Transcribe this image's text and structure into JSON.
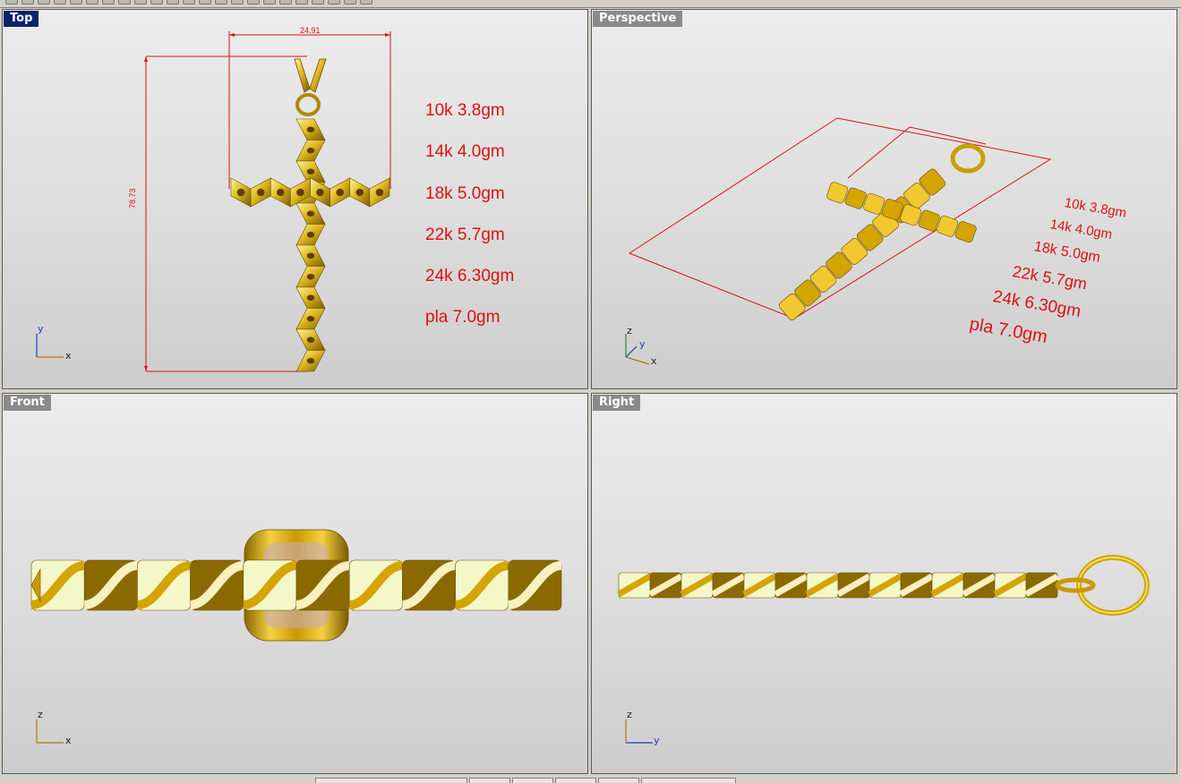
{
  "viewports": {
    "top": {
      "label": "Top"
    },
    "perspective": {
      "label": "Perspective"
    },
    "front": {
      "label": "Front"
    },
    "right": {
      "label": "Right"
    }
  },
  "dimensions": {
    "width": "24.91",
    "height": "78.73"
  },
  "weights": [
    "10k 3.8gm",
    "14k 4.0gm",
    "18k 5.0gm",
    "22k 5.7gm",
    "24k 6.30gm",
    "pla 7.0gm"
  ],
  "axes": {
    "x": "x",
    "y": "y",
    "z": "z"
  },
  "colors": {
    "dimension": "#dd1111",
    "gold_dark": "#8a6a00",
    "gold_mid": "#d4a400",
    "gold_light": "#f8f4a8",
    "pale_band": "#f4f8c8",
    "active_tab": "#0a246a"
  }
}
